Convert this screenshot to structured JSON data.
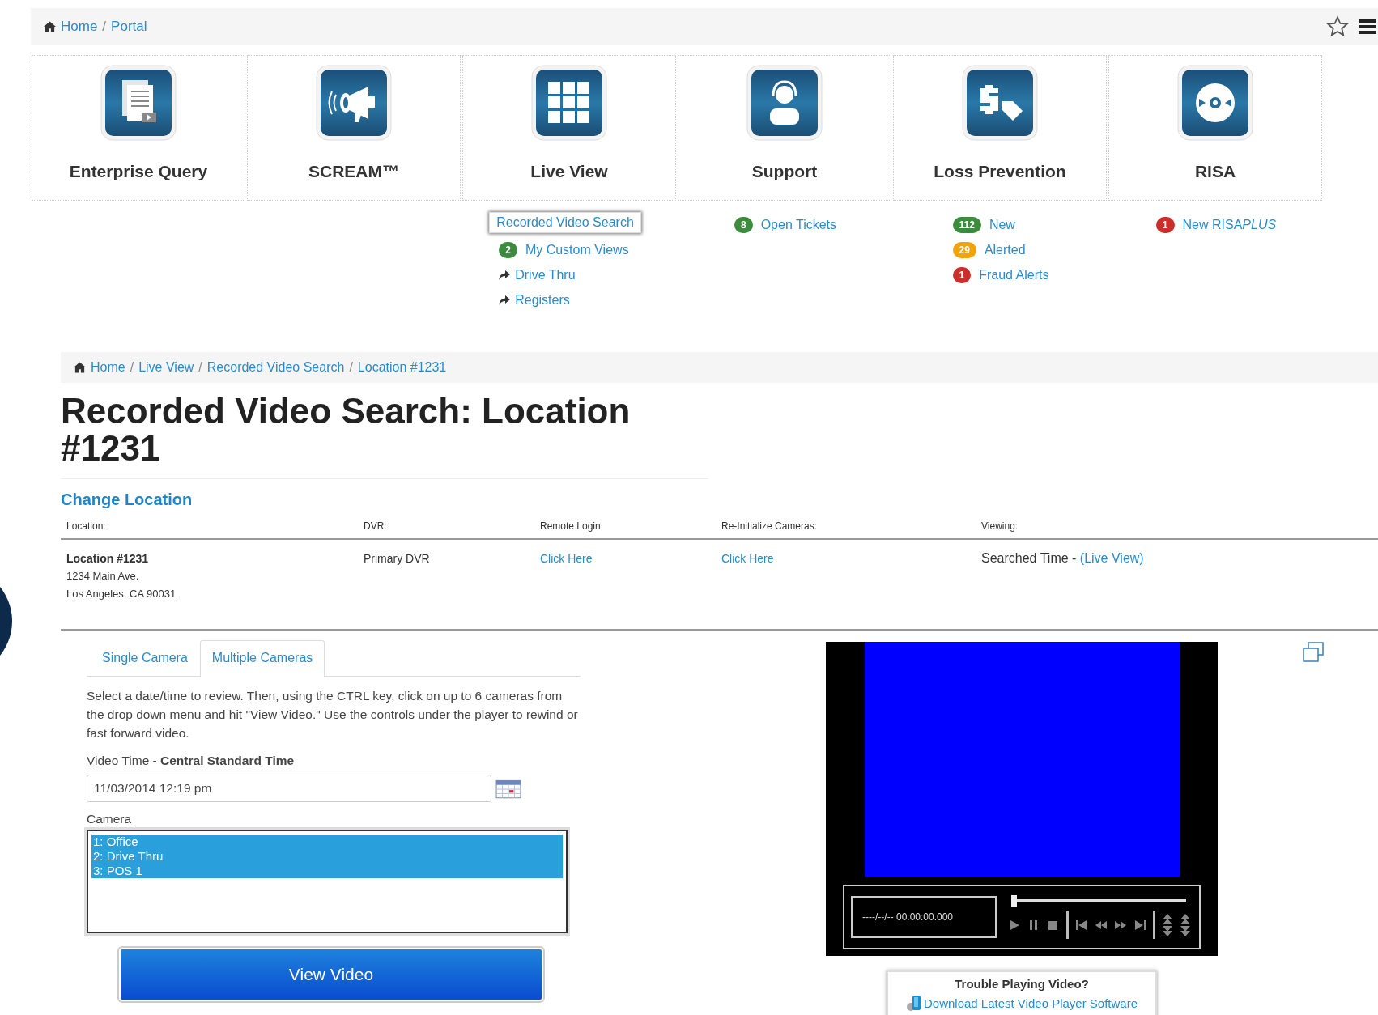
{
  "top_breadcrumb": [
    {
      "label": "Home"
    },
    {
      "sep": "/",
      "label": "Portal"
    }
  ],
  "tiles": [
    {
      "label": "Enterprise Query"
    },
    {
      "label": "SCREAM™"
    },
    {
      "label": "Live View",
      "links": [
        {
          "kind": "boxed",
          "label": "Recorded Video Search"
        },
        {
          "kind": "badge",
          "badge": "2",
          "color": "#3d8b3d",
          "label": "My Custom Views"
        },
        {
          "kind": "arrow",
          "label": "Drive Thru"
        },
        {
          "kind": "arrow",
          "label": "Registers"
        }
      ]
    },
    {
      "label": "Support",
      "links": [
        {
          "kind": "badge",
          "badge": "8",
          "color": "#3d8b3d",
          "label": "Open Tickets"
        }
      ]
    },
    {
      "label": "Loss Prevention",
      "links": [
        {
          "kind": "badge",
          "badge": "112",
          "color": "#3d8b3d",
          "label": "New"
        },
        {
          "kind": "badge",
          "badge": "29",
          "color": "#f0a30a",
          "label": "Alerted"
        },
        {
          "kind": "badge",
          "badge": "1",
          "color": "#c9302c",
          "label": "Fraud Alerts"
        }
      ]
    },
    {
      "label": "RISA",
      "links": [
        {
          "kind": "badge",
          "badge": "1",
          "color": "#c9302c",
          "label": "New RISA",
          "italic_suffix": "PLUS"
        }
      ]
    }
  ],
  "breadcrumb": [
    {
      "label": "Home"
    },
    {
      "sep": "/",
      "label": "Live View"
    },
    {
      "sep": "/",
      "label": "Recorded Video Search"
    },
    {
      "sep": "/",
      "label": "Location #1231"
    }
  ],
  "title": "Recorded Video Search: Location #1231",
  "change_location": "Change Location",
  "location_table": {
    "columns": [
      "Location:",
      "DVR:",
      "Remote Login:",
      "Re-Initialize Cameras:",
      "Viewing:"
    ],
    "location_name": "Location #1231",
    "address_lines": [
      "1234 Main Ave.",
      "Los Angeles, CA 90031"
    ],
    "dvr": "Primary DVR",
    "remote_login": "Click Here",
    "reinitialize": "Click Here",
    "viewing": "Searched Time - ",
    "viewing_link": "(Live View)"
  },
  "tabs": [
    {
      "label": "Single Camera",
      "selected": false
    },
    {
      "label": "Multiple Cameras",
      "selected": true
    }
  ],
  "instructions": "Select a date/time to review. Then, using the CTRL key, click on up to 6 cameras from the drop down menu and hit \"View Video.\" Use the controls under the player to rewind or fast forward video.",
  "video_time_label": "Video Time - **Central Standard Time**",
  "video_time": "11/03/2014 12:19 pm",
  "camera_label": "Camera",
  "cameras": [
    {
      "label": "1: Office",
      "selected": true
    },
    {
      "label": "2: Drive Thru",
      "selected": true
    },
    {
      "label": "3: POS 1",
      "selected": true
    }
  ],
  "view_button": "View Video",
  "player": {
    "timecode": "----/--/-- 00:00:00.000",
    "level": 0
  },
  "trouble": {
    "title": "Trouble Playing Video?",
    "link": "Download Latest Video Player Software"
  }
}
